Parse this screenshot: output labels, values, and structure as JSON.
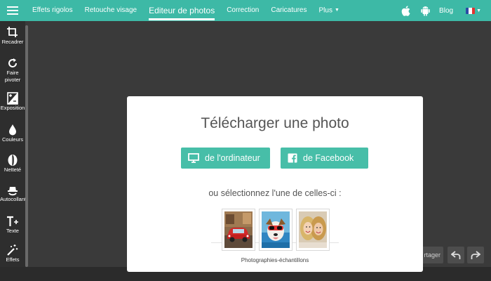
{
  "nav": {
    "items": [
      {
        "label": "Effets rigolos"
      },
      {
        "label": "Retouche visage"
      },
      {
        "label": "Editeur de photos"
      },
      {
        "label": "Correction"
      },
      {
        "label": "Caricatures"
      },
      {
        "label": "Plus"
      }
    ],
    "blog": "Blog"
  },
  "sidebar": {
    "items": [
      {
        "label": "Recadrer",
        "icon": "crop-icon"
      },
      {
        "label": "Faire pivoter",
        "icon": "rotate-icon"
      },
      {
        "label": "Exposition",
        "icon": "exposure-icon"
      },
      {
        "label": "Couleurs",
        "icon": "color-drop-icon"
      },
      {
        "label": "Netteté",
        "icon": "sharpness-icon"
      },
      {
        "label": "Autocollant",
        "icon": "sticker-icon"
      },
      {
        "label": "Texte",
        "icon": "text-icon"
      },
      {
        "label": "Effets",
        "icon": "magic-wand-icon"
      }
    ]
  },
  "dialog": {
    "title": "Télécharger une photo",
    "from_computer": "de l'ordinateur",
    "from_facebook": "de Facebook",
    "subtitle": "ou sélectionnez l'une de celles-ci :",
    "samples_caption": "Photographies-échantillons"
  },
  "toolbar": {
    "share_partial": "rtager"
  },
  "colors": {
    "accent": "#3db9a6",
    "button": "#47bea8",
    "sidebar_bg": "#2e2e2e",
    "canvas_bg": "#3a3a3a"
  }
}
